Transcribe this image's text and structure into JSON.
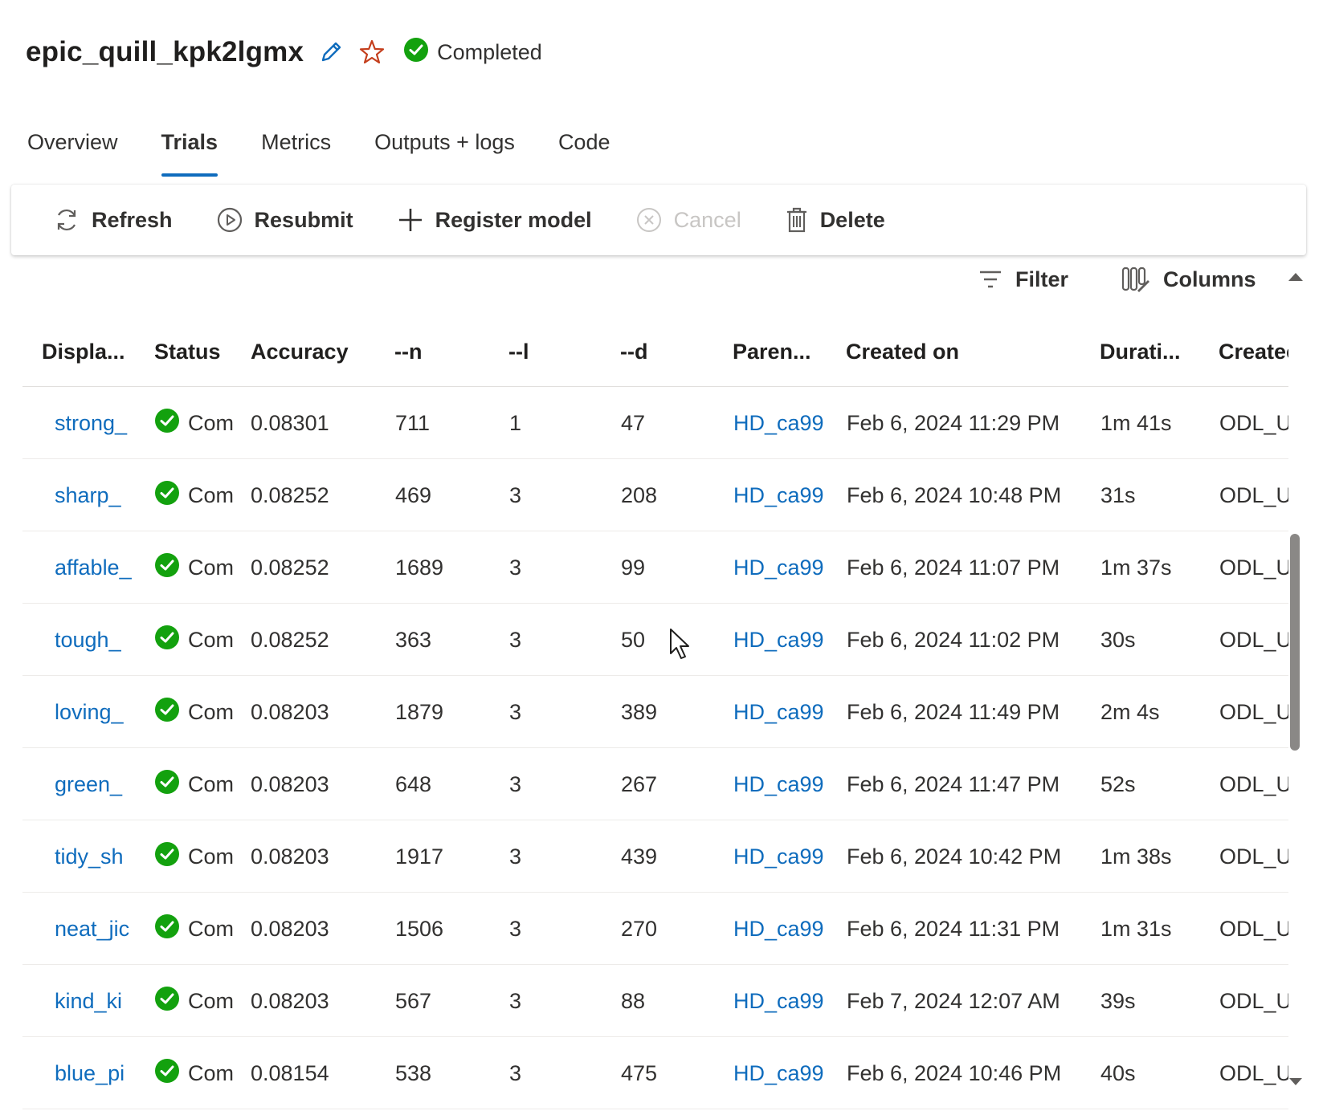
{
  "header": {
    "run_name": "epic_quill_kpk2lgmx",
    "status": "Completed",
    "edit_icon": "pencil-icon",
    "favorite_icon": "star-icon",
    "status_icon": "check-circle-icon",
    "colors": {
      "status_green": "#13a10e",
      "favorite": "#c43e1c",
      "accent": "#0f6cbd"
    }
  },
  "tabs": [
    {
      "label": "Overview",
      "active": false
    },
    {
      "label": "Trials",
      "active": true
    },
    {
      "label": "Metrics",
      "active": false
    },
    {
      "label": "Outputs + logs",
      "active": false
    },
    {
      "label": "Code",
      "active": false
    }
  ],
  "toolbar": {
    "refresh": "Refresh",
    "resubmit": "Resubmit",
    "register_model": "Register model",
    "cancel": "Cancel",
    "delete": "Delete"
  },
  "filterbar": {
    "filter": "Filter",
    "columns": "Columns"
  },
  "table": {
    "columns": [
      "Displa...",
      "Status",
      "Accuracy",
      "--n",
      "--l",
      "--d",
      "Paren...",
      "Created on",
      "Durati...",
      "Createc"
    ],
    "rows": [
      {
        "display": "strong_",
        "status": "Com",
        "accuracy": "0.08301",
        "n": "711",
        "l": "1",
        "d": "47",
        "parent": "HD_ca99",
        "created_on": "Feb 6, 2024 11:29 PM",
        "duration": "1m 41s",
        "created_by": "ODL_U"
      },
      {
        "display": "sharp_",
        "status": "Com",
        "accuracy": "0.08252",
        "n": "469",
        "l": "3",
        "d": "208",
        "parent": "HD_ca99",
        "created_on": "Feb 6, 2024 10:48 PM",
        "duration": "31s",
        "created_by": "ODL_U"
      },
      {
        "display": "affable_",
        "status": "Com",
        "accuracy": "0.08252",
        "n": "1689",
        "l": "3",
        "d": "99",
        "parent": "HD_ca99",
        "created_on": "Feb 6, 2024 11:07 PM",
        "duration": "1m 37s",
        "created_by": "ODL_U"
      },
      {
        "display": "tough_",
        "status": "Com",
        "accuracy": "0.08252",
        "n": "363",
        "l": "3",
        "d": "50",
        "parent": "HD_ca99",
        "created_on": "Feb 6, 2024 11:02 PM",
        "duration": "30s",
        "created_by": "ODL_U"
      },
      {
        "display": "loving_",
        "status": "Com",
        "accuracy": "0.08203",
        "n": "1879",
        "l": "3",
        "d": "389",
        "parent": "HD_ca99",
        "created_on": "Feb 6, 2024 11:49 PM",
        "duration": "2m 4s",
        "created_by": "ODL_U"
      },
      {
        "display": "green_",
        "status": "Com",
        "accuracy": "0.08203",
        "n": "648",
        "l": "3",
        "d": "267",
        "parent": "HD_ca99",
        "created_on": "Feb 6, 2024 11:47 PM",
        "duration": "52s",
        "created_by": "ODL_U"
      },
      {
        "display": "tidy_sh",
        "status": "Com",
        "accuracy": "0.08203",
        "n": "1917",
        "l": "3",
        "d": "439",
        "parent": "HD_ca99",
        "created_on": "Feb 6, 2024 10:42 PM",
        "duration": "1m 38s",
        "created_by": "ODL_U"
      },
      {
        "display": "neat_jic",
        "status": "Com",
        "accuracy": "0.08203",
        "n": "1506",
        "l": "3",
        "d": "270",
        "parent": "HD_ca99",
        "created_on": "Feb 6, 2024 11:31 PM",
        "duration": "1m 31s",
        "created_by": "ODL_U"
      },
      {
        "display": "kind_ki",
        "status": "Com",
        "accuracy": "0.08203",
        "n": "567",
        "l": "3",
        "d": "88",
        "parent": "HD_ca99",
        "created_on": "Feb 7, 2024 12:07 AM",
        "duration": "39s",
        "created_by": "ODL_U"
      },
      {
        "display": "blue_pi",
        "status": "Com",
        "accuracy": "0.08154",
        "n": "538",
        "l": "3",
        "d": "475",
        "parent": "HD_ca99",
        "created_on": "Feb 6, 2024 10:46 PM",
        "duration": "40s",
        "created_by": "ODL_U"
      }
    ]
  }
}
